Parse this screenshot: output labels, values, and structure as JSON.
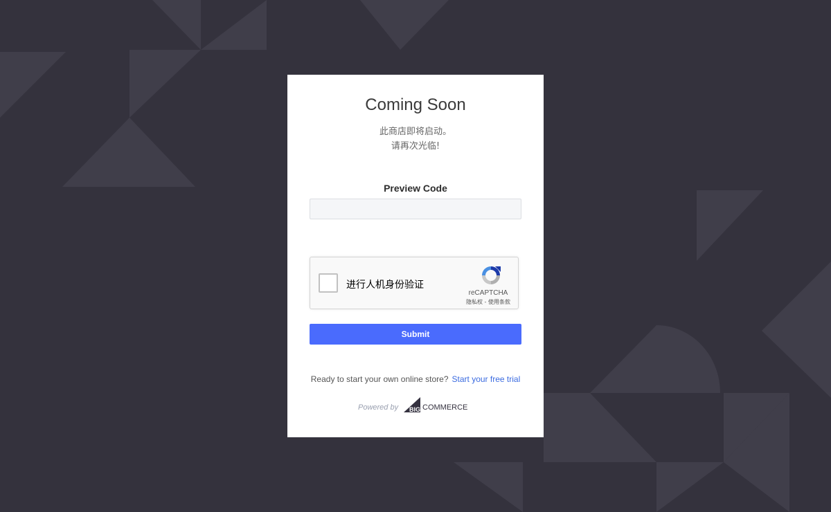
{
  "card": {
    "title": "Coming Soon",
    "message_line1": "此商店即将启动。",
    "message_line2": "请再次光临!"
  },
  "preview": {
    "label": "Preview Code",
    "value": "",
    "placeholder": ""
  },
  "recaptcha": {
    "label": "进行人机身份验证",
    "brand": "reCAPTCHA",
    "links": "隐私权 - 使用条款"
  },
  "submit": {
    "label": "Submit"
  },
  "footer": {
    "prompt": "Ready to start your own online store?",
    "link": "Start your free trial",
    "powered_by": "Powered by",
    "logo_big": "BIG",
    "logo_commerce": "COMMERCE"
  },
  "colors": {
    "background": "#34323d",
    "card": "#ffffff",
    "accent": "#4a6bfd",
    "link": "#3b6be0"
  }
}
